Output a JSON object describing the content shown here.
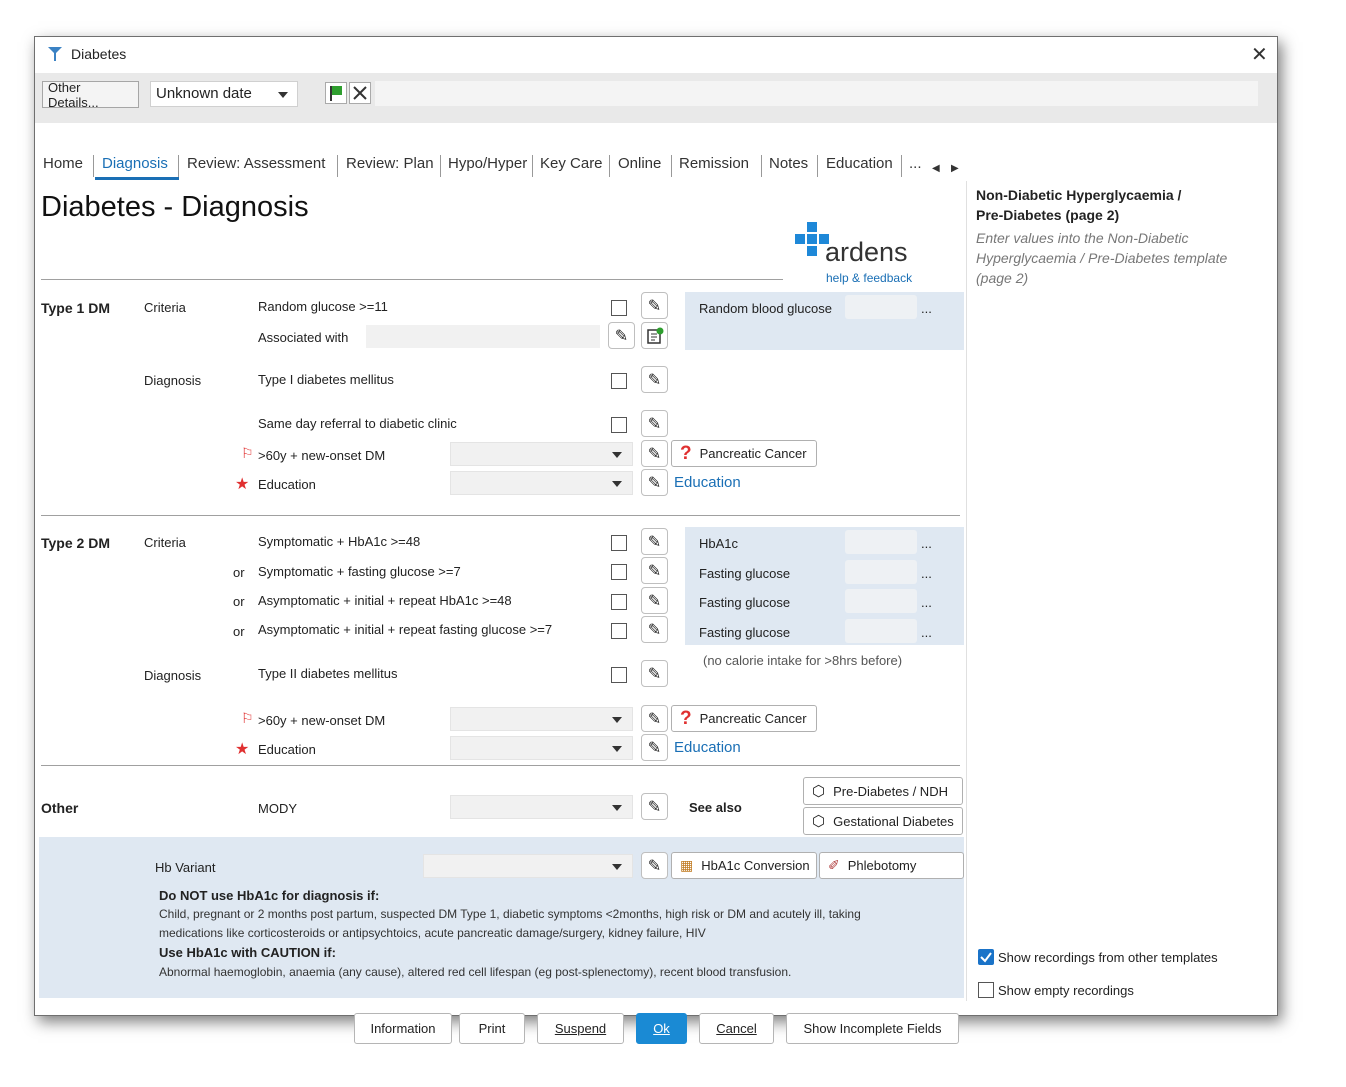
{
  "window": {
    "title": "Diabetes",
    "close": "✕"
  },
  "toolbar": {
    "other_details": "Other Details...",
    "date": "Unknown date"
  },
  "tabs": [
    "Home",
    "Diagnosis",
    "Review: Assessment",
    "Review: Plan",
    "Hypo/Hyper",
    "Key Care",
    "Online",
    "Remission",
    "Notes",
    "Education",
    "..."
  ],
  "page_title": "Diabetes - Diagnosis",
  "logo": {
    "brand": "ardens",
    "help": "help & feedback"
  },
  "type1": {
    "section": "Type 1 DM",
    "criteria": "Criteria",
    "random_glucose": "Random glucose >=11",
    "associated_with": "Associated with",
    "diagnosis": "Diagnosis",
    "type1_dm": "Type I diabetes mellitus",
    "referral": "Same day referral to diabetic clinic",
    "over60": ">60y + new-onset DM",
    "education": "Education",
    "pancreatic": "Pancreatic Cancer",
    "education_link": "Education",
    "panel_label": "Random blood glucose",
    "ellipsis": "..."
  },
  "type2": {
    "section": "Type 2 DM",
    "criteria": "Criteria",
    "or": "or",
    "c1": "Symptomatic + HbA1c >=48",
    "c2": "Symptomatic + fasting glucose >=7",
    "c3": "Asymptomatic + initial + repeat HbA1c >=48",
    "c4": "Asymptomatic + initial + repeat fasting glucose >=7",
    "diagnosis": "Diagnosis",
    "type2_dm": "Type II diabetes mellitus",
    "over60": ">60y + new-onset DM",
    "education": "Education",
    "pancreatic": "Pancreatic Cancer",
    "education_link": "Education",
    "panel": [
      "HbA1c",
      "Fasting glucose",
      "Fasting glucose",
      "Fasting glucose"
    ],
    "note": "(no calorie intake for >8hrs before)",
    "ellipsis": "..."
  },
  "other": {
    "section": "Other",
    "mody": "MODY",
    "see_also": "See also",
    "prediabetes": "Pre-Diabetes / NDH",
    "gestational": "Gestational Diabetes"
  },
  "hb": {
    "label": "Hb Variant",
    "conversion": "HbA1c Conversion",
    "phlebotomy": "Phlebotomy",
    "warn1_title": "Do NOT use HbA1c for diagnosis if:",
    "warn1_l1": "Child, pregnant or 2 months post partum, suspected DM Type 1, diabetic symptoms <2months, high risk or DM and acutely ill, taking",
    "warn1_l2": "medications like corticosteroids or antipsychtoics, acute pancreatic damage/surgery, kidney failure, HIV",
    "warn2_title": "Use HbA1c with CAUTION if:",
    "warn2_l1": "Abnormal haemoglobin, anaemia (any cause), altered red cell lifespan (eg post-splenectomy), recent blood transfusion."
  },
  "side": {
    "title_l1": "Non-Diabetic Hyperglycaemia /",
    "title_l2": "Pre-Diabetes (page 2)",
    "desc_l1": "Enter values into the Non-Diabetic",
    "desc_l2": "Hyperglycaemia / Pre-Diabetes template",
    "desc_l3": "(page 2)",
    "show_other": "Show recordings from other templates",
    "show_empty": "Show empty recordings"
  },
  "buttons": {
    "information": "Information",
    "print": "Print",
    "suspend": "Suspend",
    "ok": "Ok",
    "cancel": "Cancel",
    "incomplete": "Show Incomplete Fields"
  },
  "colors": {
    "accent": "#1a6fb5",
    "panel": "#dfe8f2",
    "ok": "#1a8ad4",
    "warning": "#e03030"
  }
}
